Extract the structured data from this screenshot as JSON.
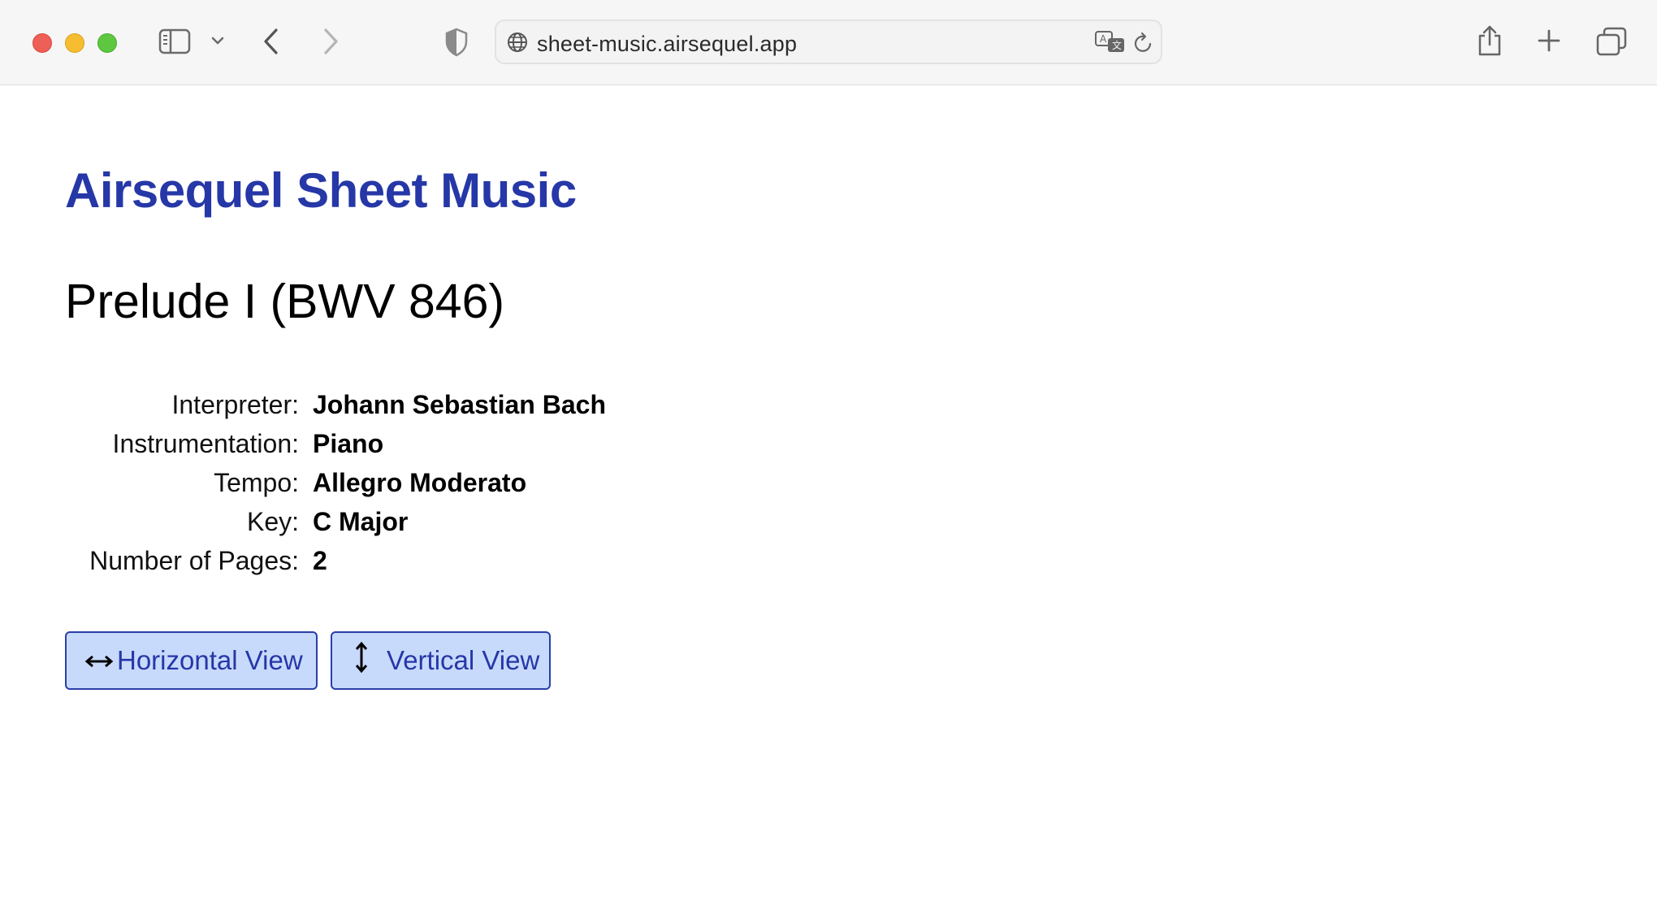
{
  "browser": {
    "url": "sheet-music.airsequel.app",
    "icons": {
      "sidebar": "sidebar-icon",
      "chevron": "chevron-down-icon",
      "back": "back-arrow-icon",
      "forward": "forward-arrow-icon",
      "privacy": "shield-icon",
      "site": "globe-icon",
      "translate": "translate-icon",
      "reload": "reload-icon",
      "share": "share-icon",
      "new_tab": "plus-icon",
      "tabs": "tab-overview-icon"
    }
  },
  "page": {
    "site_title": "Airsequel Sheet Music",
    "piece_title": "Prelude I (BWV 846)",
    "details": [
      {
        "label": "Interpreter:",
        "value": "Johann Sebastian Bach"
      },
      {
        "label": "Instrumentation:",
        "value": "Piano"
      },
      {
        "label": "Tempo:",
        "value": "Allegro Moderato"
      },
      {
        "label": "Key:",
        "value": "C Major"
      },
      {
        "label": "Number of Pages:",
        "value": "2"
      }
    ],
    "buttons": {
      "horizontal": "Horizontal View",
      "vertical": "Vertical View"
    }
  },
  "colors": {
    "accent": "#2637a7",
    "button_bg": "#c8dafb",
    "toolbar_bg": "#f6f6f6"
  }
}
